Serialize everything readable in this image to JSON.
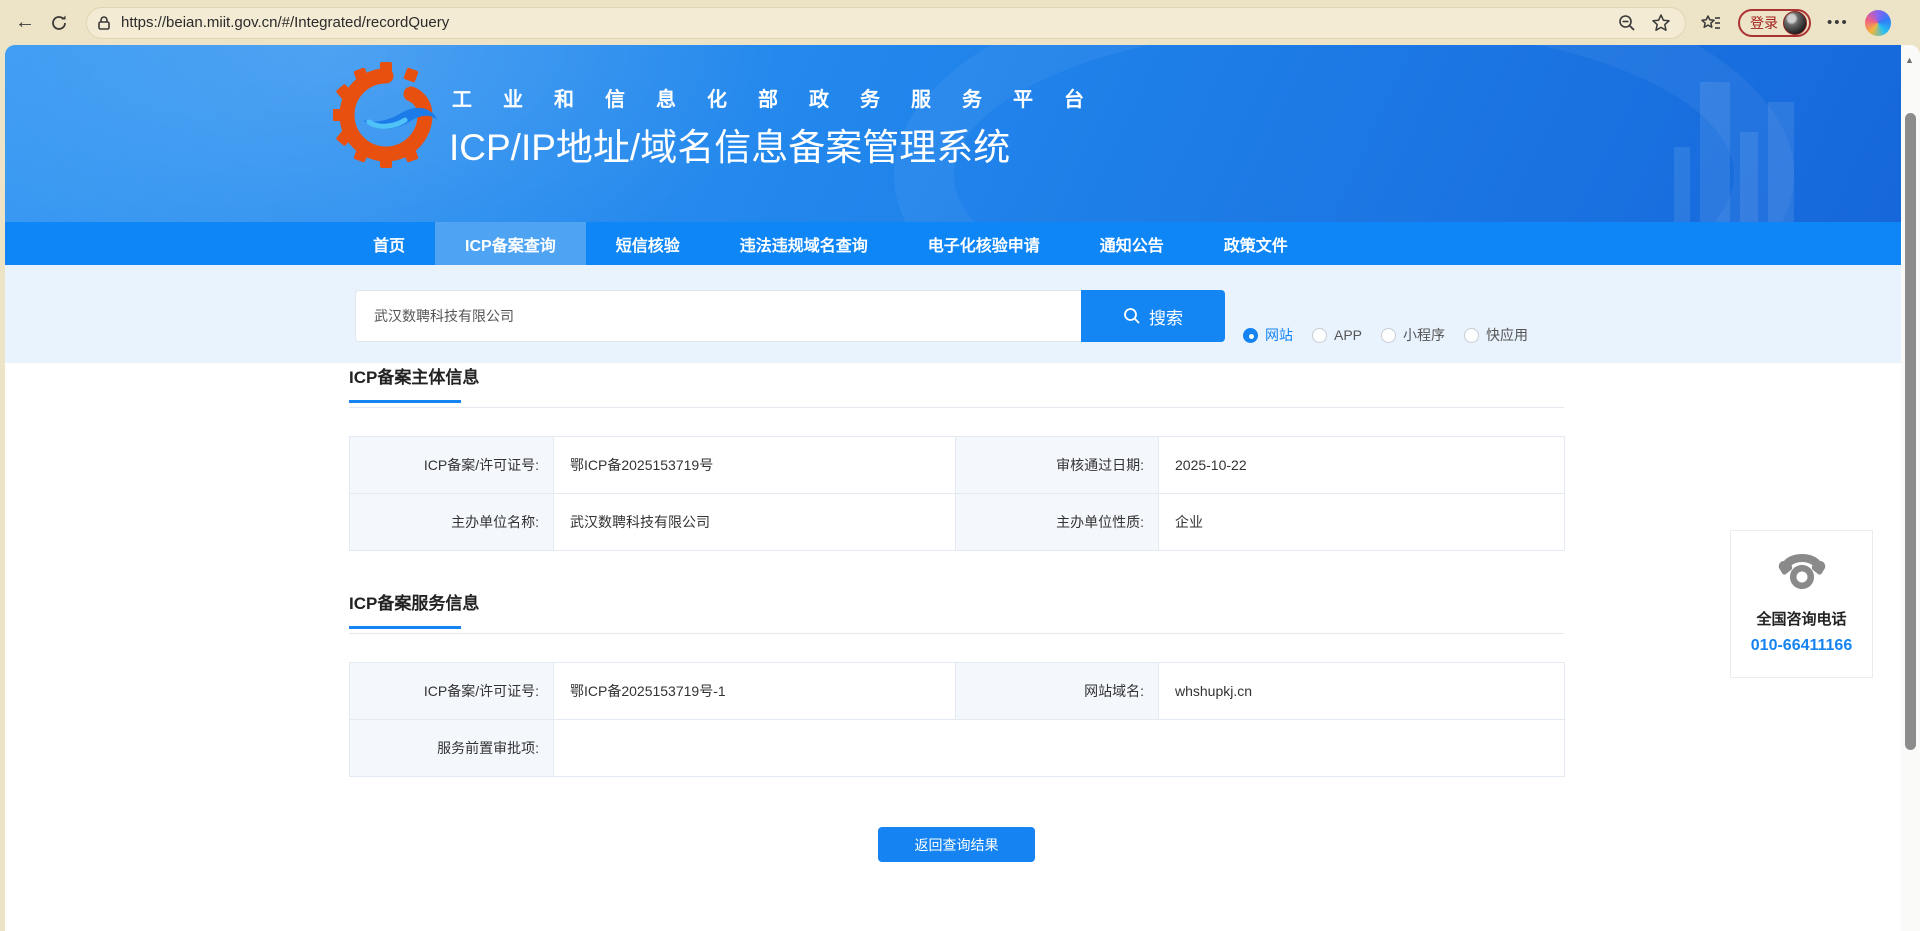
{
  "browser": {
    "url": "https://beian.miit.gov.cn/#/Integrated/recordQuery",
    "login_label": "登录",
    "more_label": "•••"
  },
  "header": {
    "slogan": "工业和信息化部政务服务平台",
    "title": "ICP/IP地址/域名信息备案管理系统"
  },
  "nav": {
    "items": [
      {
        "label": "首页",
        "active": false
      },
      {
        "label": "ICP备案查询",
        "active": true
      },
      {
        "label": "短信核验",
        "active": false
      },
      {
        "label": "违法违规域名查询",
        "active": false
      },
      {
        "label": "电子化核验申请",
        "active": false
      },
      {
        "label": "通知公告",
        "active": false
      },
      {
        "label": "政策文件",
        "active": false
      }
    ]
  },
  "search": {
    "value": "武汉数聘科技有限公司",
    "button_label": "搜索",
    "types": [
      {
        "label": "网站",
        "selected": true
      },
      {
        "label": "APP",
        "selected": false
      },
      {
        "label": "小程序",
        "selected": false
      },
      {
        "label": "快应用",
        "selected": false
      }
    ]
  },
  "subject": {
    "title": "ICP备案主体信息",
    "row1": {
      "label1": "ICP备案/许可证号:",
      "value1": "鄂ICP备2025153719号",
      "label2": "审核通过日期:",
      "value2": "2025-10-22"
    },
    "row2": {
      "label1": "主办单位名称:",
      "value1": "武汉数聘科技有限公司",
      "label2": "主办单位性质:",
      "value2": "企业"
    }
  },
  "service": {
    "title": "ICP备案服务信息",
    "row1": {
      "label1": "ICP备案/许可证号:",
      "value1": "鄂ICP备2025153719号-1",
      "label2": "网站域名:",
      "value2": "whshupkj.cn"
    },
    "row2": {
      "label": "服务前置审批项:",
      "value": ""
    }
  },
  "back_button_label": "返回查询结果",
  "hotline": {
    "label": "全国咨询电话",
    "number": "010-66411166"
  },
  "colors": {
    "accent": "#1584F2",
    "nav_bg": "#0E86F6",
    "nav_active": "#4FA3F3",
    "chrome_bg": "#EDE3C6",
    "login_red": "#A22020"
  }
}
